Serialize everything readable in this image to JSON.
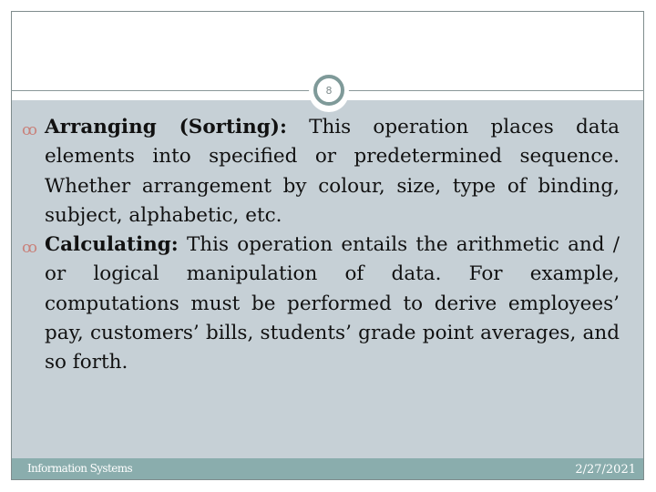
{
  "slide": {
    "page_number": "8",
    "bullet_icon": "ꝏ",
    "bullets": [
      {
        "term": "Arranging (Sorting):",
        "text": " This operation places data elements into specified or predetermined sequence. Whether arrangement by colour, size, type of binding, subject, alphabetic, etc."
      },
      {
        "term": "Calculating:",
        "text": " This operation entails the arithmetic and / or logical manipulation of data. For example, computations must be performed to derive employees’ pay, customers’ bills, students’ grade point averages, and so forth."
      }
    ]
  },
  "footer": {
    "title": "Information Systems",
    "date": "2/27/2021"
  },
  "colors": {
    "content_background": "#c6d0d6",
    "footer_background": "#8aadad",
    "bullet_color": "#c9817a",
    "badge_ring": "#7f9a99"
  }
}
